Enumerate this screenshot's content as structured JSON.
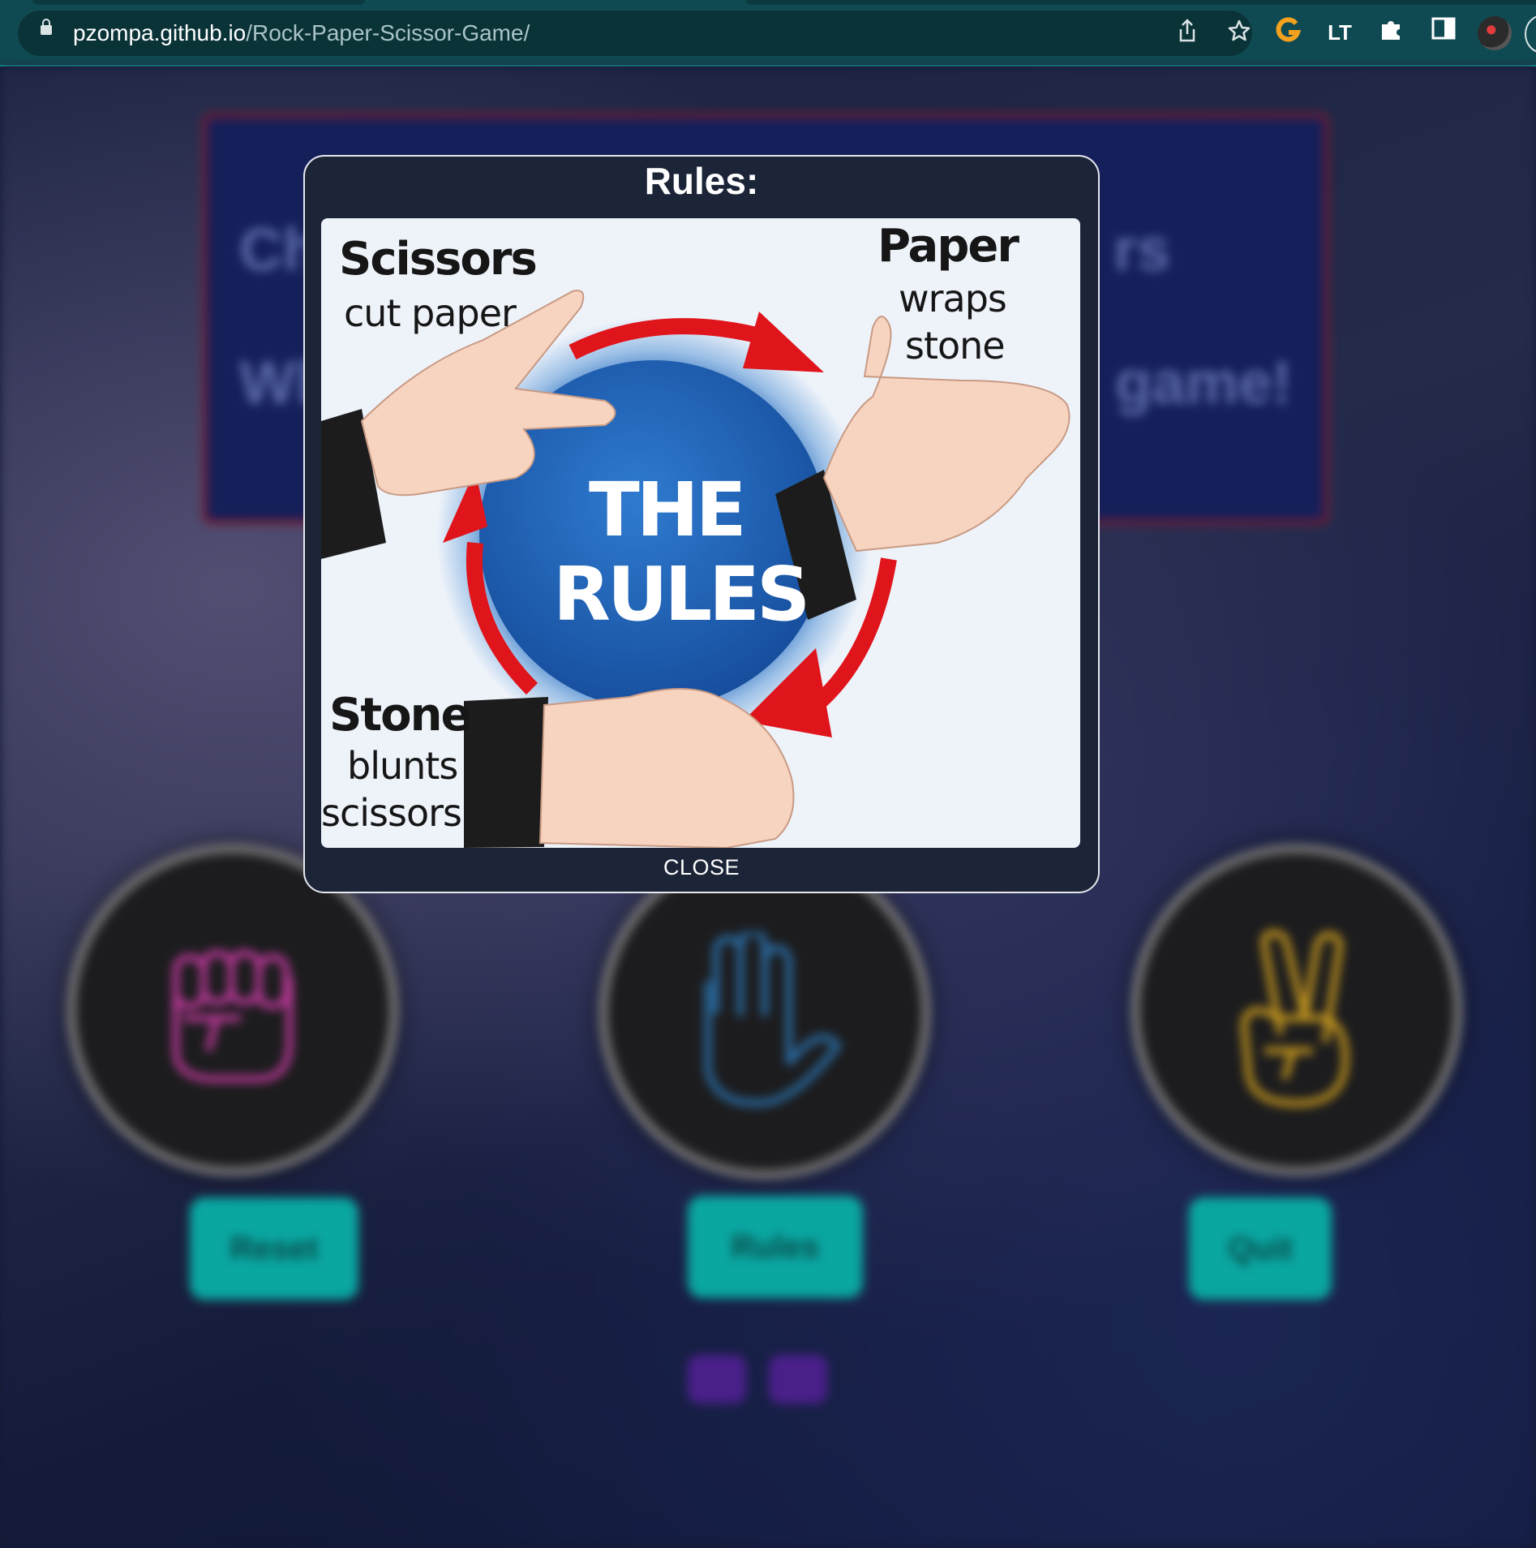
{
  "browser": {
    "url_host": "pzompa.github.io",
    "url_path": "/Rock-Paper-Scissor-Game/",
    "icons": [
      "lock-icon",
      "share-icon",
      "bookmark-star-icon",
      "grammarly-extension-icon",
      "translate-extension-icon",
      "extensions-puzzle-icon",
      "side-panel-icon",
      "profile-avatar"
    ]
  },
  "background_page": {
    "banner_fragments": [
      "Ch",
      "rs",
      "Wh",
      "game!"
    ],
    "choices": [
      {
        "name": "rock",
        "icon": "fist-icon",
        "color": "#c23a9e"
      },
      {
        "name": "paper",
        "icon": "hand-icon",
        "color": "#2a6fa8"
      },
      {
        "name": "scissors",
        "icon": "peace-hand-icon",
        "color": "#c99a1e"
      }
    ],
    "buttons": {
      "reset": "Reset",
      "rules": "Rules",
      "quit": "Quit"
    },
    "social": [
      "twitter-icon",
      "youtube-icon"
    ]
  },
  "modal": {
    "title": "Rules:",
    "close_label": "CLOSE",
    "image": {
      "center_line1": "THE",
      "center_line2": "RULES",
      "scissors_title": "Scissors",
      "scissors_text": "cut paper",
      "paper_title": "Paper",
      "paper_text1": "wraps",
      "paper_text2": "stone",
      "stone_title": "Stone",
      "stone_text1": "blunts",
      "stone_text2": "scissors",
      "arrow_color": "#e0141b",
      "circle_color": "#1c5aa8"
    }
  }
}
